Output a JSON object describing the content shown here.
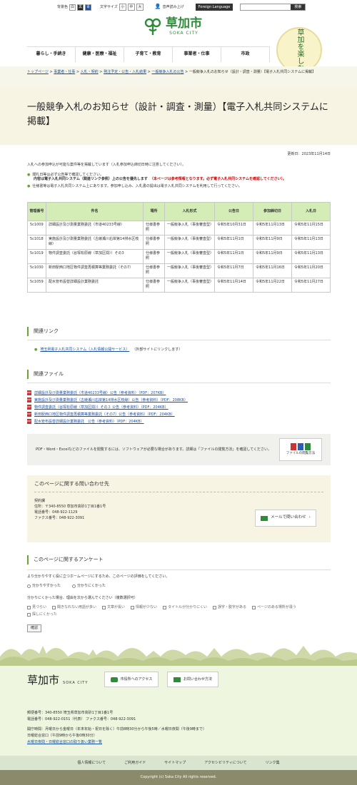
{
  "topbar": {
    "color_label": "背景色",
    "color_options": [
      "白",
      "黒",
      "青"
    ],
    "text_size_label": "文字サイズ",
    "text_size_options": [
      "小",
      "中",
      "大"
    ],
    "read_aloud": "音声読み上げ",
    "foreign_language": "Foreign Language",
    "search_placeholder": "",
    "search_button": "検索"
  },
  "header": {
    "logo_jp": "草加市",
    "logo_en": "SOKA CITY",
    "badge_text": "草加を楽しむ"
  },
  "gnav": [
    "暮らし・手続き",
    "健康・医療・福祉",
    "子育て・教育",
    "事業者・仕事",
    "市政"
  ],
  "breadcrumb": {
    "links": [
      "トップページ",
      "事業者・仕事",
      "入札・契約",
      "発注予定・公告・入札結果",
      "一般競争入札の公告"
    ],
    "current": "一般競争入札のお知らせ（設計・調査・測量）【電子入札共同システムに掲載】"
  },
  "page_title": "一般競争入札のお知らせ（設計・調査・測量）【電子入札共同システムに掲載】",
  "update_date": "更新日：2023年11月14日",
  "intro": "入札への参加申込が可能な案件等を掲載しています（入札参加申込締切日時に注意してください）。",
  "notes": {
    "n1": "閲札日等は必ず公告等で確認してください。",
    "n2_bold": "内容は電子入札共同システム（関連リンク参照）上の公告を優先します",
    "n2_red": "（本ページは参考情報となります。必ず電子入札共同システムを確認してください）。",
    "n3": "仕様書等は電子入札共同システム上にあります。参加申し込み、入札書の提出は電子入札共同システムを利用して行ってください。"
  },
  "table": {
    "headers": [
      "管理番号",
      "件名",
      "場所",
      "入札形式",
      "公告日",
      "参加締切日",
      "入札日"
    ],
    "rows": [
      [
        "5c1009",
        "詳細設計及び測量業務委託（市道40233号線）",
        "仕様書参照",
        "一般競争入札（事後審査型）",
        "令和5年10月31日",
        "令和5年11月13日",
        "令和5年11月15日"
      ],
      [
        "5c1018",
        "実施設計及び測量業務委託（古綾瀬川右岸第14排水区枝線）",
        "仕様書参照",
        "一般競争入札（事後審査型）",
        "令和5年11月1日",
        "令和5年11月9日",
        "令和5年11月13日"
      ],
      [
        "5c1019",
        "物件調査委託（谷塚松原線（草加区間））その3",
        "仕様書参照",
        "一般競争入札（事後審査型）",
        "令和5年11月1日",
        "令和5年11月9日",
        "令和5年11月13日"
      ],
      [
        "5c1030",
        "新田駅西口地区物件調査再積算等業務委託（その7）",
        "仕様書参照",
        "一般競争入札（事後審査型）",
        "令和5年11月7日",
        "令和5年11月16日",
        "令和5年11月20日"
      ],
      [
        "5c1059",
        "配水管布設替詳細設計業務委託",
        "仕様書参照",
        "一般競争入札（事後審査型）",
        "令和5年11月14日",
        "令和5年11月22日",
        "令和5年11月27日"
      ]
    ]
  },
  "related_links": {
    "heading": "関連リンク",
    "link": "埼玉県電子入札共同システム（入札情報公開サービス）",
    "note": "（外部サイトにリンクします）"
  },
  "related_files": {
    "heading": "関連ファイル",
    "files": [
      "詳細設計及び測量業務委託（市道40233号線）公告（参考資料）（PDF：207KB）",
      "実施設計及び測量業務委託（古綾瀬川右岸第14排水区枝線）公告（参考資料）（PDF：208KB）",
      "物件調査委託（谷塚松原線（草加区間））その３ 公告（参考資料）（PDF：204KB）",
      "新田駅西口地区物件調査再積算等業務委託（その7）公告（参考資料）（PDF：204KB）",
      "配水管布設替詳細設計業務委託　公告（参考資料）（PDF：204KB）"
    ],
    "viewer_note": "PDF・Word・Excelなどのファイルを閲覧するには、ソフトウェアが必要な場合があります。詳細は「ファイルの閲覧方法」を確認してください。",
    "viewer_button": "ファイルの閲覧方法"
  },
  "contact": {
    "heading": "このページに関する問い合わせ先",
    "dept": "契約課",
    "address": "住所：〒340-8550 草加市高砂1丁目1番1号",
    "tel": "電話番号：048-922-1129",
    "fax": "ファクス番号：048-922-3091",
    "mail_button": "メールで問い合わせ"
  },
  "survey": {
    "heading": "このページに関するアンケート",
    "q1": "より分かりやすく役に立つホームページにするため、このページの評価をしてください。",
    "opt1": "分かりやすかった",
    "opt2": "分かりにくかった",
    "q2": "分かりにくかった場合、理由を次から選んでください（複数選択可）",
    "reasons": [
      "見づらい",
      "聞きなれない用語が多い",
      "文章が長い",
      "情報が少ない",
      "タイトルが分かりにくい",
      "誤字・脱字がある",
      "ページのある場所が違う",
      "探しにくかった"
    ],
    "submit": "確認"
  },
  "footer": {
    "logo_jp": "草加市",
    "logo_en": "SOKA CITY",
    "btn_access": "市役所へのアクセス",
    "btn_contact": "お問い合わせ方法",
    "address": "郵便番号：340-8550 埼玉県草加市高砂1丁目1番1号",
    "phone": "電話番号：048-922-0151（代表）  ファクス番号：048-922-3091",
    "hours1": "開庁時間：月曜日から金曜日（年末年始・祝日を除く）午前8時30分から午後5時／水曜日夜間（午後9時まで）",
    "hours2": "日曜総合窓口（午前9時から午後0時30分）",
    "hours_link": "水曜日夜間・日曜総合窓口の取り扱い業務一覧",
    "links": [
      "個人情報について",
      "ご利用ガイド",
      "サイトマップ",
      "アクセシビリティについて",
      "リンク集"
    ],
    "copyright": "Copyright (c) Soka City All rights reserved."
  },
  "colors": {
    "brand_green": "#2e8b3a",
    "table_header": "#d4edb7",
    "accent_red": "#cc0000",
    "link": "#1a4fa0"
  }
}
